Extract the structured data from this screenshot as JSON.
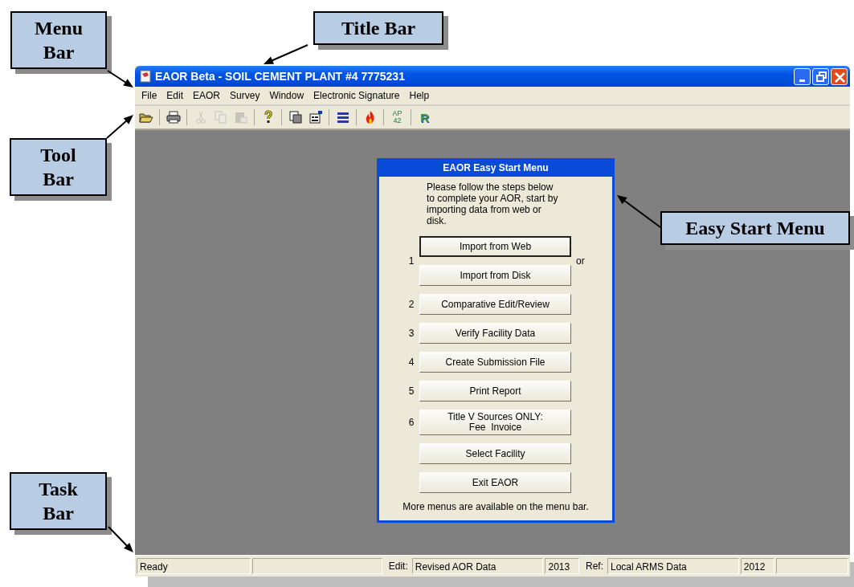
{
  "window": {
    "title": "EAOR Beta - SOIL CEMENT PLANT #4 7775231"
  },
  "menu_bar": [
    "File",
    "Edit",
    "EAOR",
    "Survey",
    "Window",
    "Electronic Signature",
    "Help"
  ],
  "toolbar": [
    [
      {
        "disabled": false
      }
    ],
    [
      {
        "disabled": false
      }
    ],
    [
      {
        "disabled": true
      },
      {
        "disabled": true
      },
      {
        "disabled": true
      }
    ],
    [
      {
        "disabled": false
      }
    ],
    [
      {
        "disabled": false
      },
      {
        "disabled": false
      }
    ],
    [
      {
        "disabled": false
      }
    ],
    [
      {
        "disabled": false
      }
    ],
    [
      {
        "disabled": false,
        "label": "AP 42"
      }
    ],
    [
      {
        "disabled": false,
        "label": "R"
      }
    ]
  ],
  "easy_start": {
    "title": "EAOR Easy Start Menu",
    "intro": "Please follow the steps below to complete your AOR, start by importing data from web or disk.",
    "steps": [
      {
        "number": "1",
        "note": "or",
        "buttons": [
          {
            "label": "Import from Web",
            "default": true
          },
          {
            "label": "Import from Disk",
            "default": false
          }
        ]
      },
      {
        "number": "2",
        "buttons": [
          {
            "label": "Comparative Edit/Review",
            "default": false
          }
        ]
      },
      {
        "number": "3",
        "buttons": [
          {
            "label": "Verify Facility Data",
            "default": false
          }
        ]
      },
      {
        "number": "4",
        "buttons": [
          {
            "label": "Create Submission File",
            "default": false
          }
        ]
      },
      {
        "number": "5",
        "buttons": [
          {
            "label": "Print Report",
            "default": false
          }
        ]
      },
      {
        "number": "6",
        "buttons": [
          {
            "label": "Title V Sources ONLY:\nFee  Invoice",
            "default": false
          }
        ]
      },
      {
        "buttons": [
          {
            "label": "Select Facility",
            "default": false
          }
        ]
      },
      {
        "buttons": [
          {
            "label": "Exit EAOR",
            "default": false
          }
        ]
      }
    ],
    "footer": "More menus are available on the menu bar."
  },
  "status_bar": [
    {
      "kind": "pane",
      "text": "Ready"
    },
    {
      "kind": "pane"
    },
    {
      "kind": "label",
      "text": "Edit:"
    },
    {
      "kind": "pane",
      "text": "Revised AOR Data"
    },
    {
      "kind": "pane",
      "text": "2013"
    },
    {
      "kind": "label",
      "text": "Ref:"
    },
    {
      "kind": "pane",
      "text": "Local ARMS Data"
    },
    {
      "kind": "pane",
      "text": "2012"
    }
  ],
  "callouts": [
    {
      "label": "Menu Bar"
    },
    {
      "label": "Title Bar"
    },
    {
      "label": "Tool Bar"
    },
    {
      "label": "Easy Start Menu"
    },
    {
      "label": "Task Bar"
    }
  ]
}
